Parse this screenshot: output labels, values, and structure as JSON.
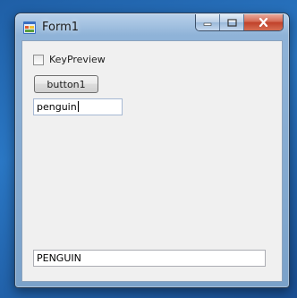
{
  "window": {
    "title": "Form1",
    "caption_buttons": [
      "minimize",
      "maximize",
      "close"
    ]
  },
  "form": {
    "checkbox": {
      "label": "KeyPreview",
      "checked": false
    },
    "button": {
      "label": "button1"
    },
    "input_textbox": {
      "value": "penguin"
    },
    "output_textbox": {
      "value": "PENGUIN"
    }
  },
  "colors": {
    "desktop": "#2a77c4",
    "client_bg": "#f0f0f0",
    "close_red": "#c0412a"
  }
}
